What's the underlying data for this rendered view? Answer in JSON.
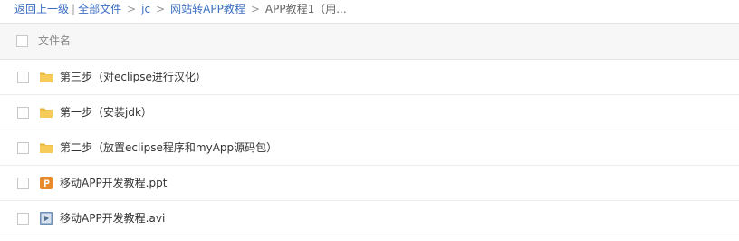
{
  "breadcrumb": {
    "back": "返回上一级",
    "all_files": "全部文件",
    "items": [
      "jc",
      "网站转APP教程"
    ],
    "current": "APP教程1（用..."
  },
  "table": {
    "header": {
      "name_column": "文件名"
    },
    "rows": [
      {
        "name": "第三步（对eclipse进行汉化）",
        "icon": "folder-icon",
        "type": "folder"
      },
      {
        "name": "第一步（安装jdk）",
        "icon": "folder-icon",
        "type": "folder"
      },
      {
        "name": "第二步（放置eclipse程序和myApp源码包）",
        "icon": "folder-icon",
        "type": "folder"
      },
      {
        "name": "移动APP开发教程.ppt",
        "icon": "ppt-icon",
        "type": "ppt"
      },
      {
        "name": "移动APP开发教程.avi",
        "icon": "video-icon",
        "type": "video"
      }
    ]
  },
  "colors": {
    "link": "#3b6fc0",
    "folder": "#f2c04a",
    "ppt": "#e8892a",
    "video": "#6d8fb5"
  }
}
